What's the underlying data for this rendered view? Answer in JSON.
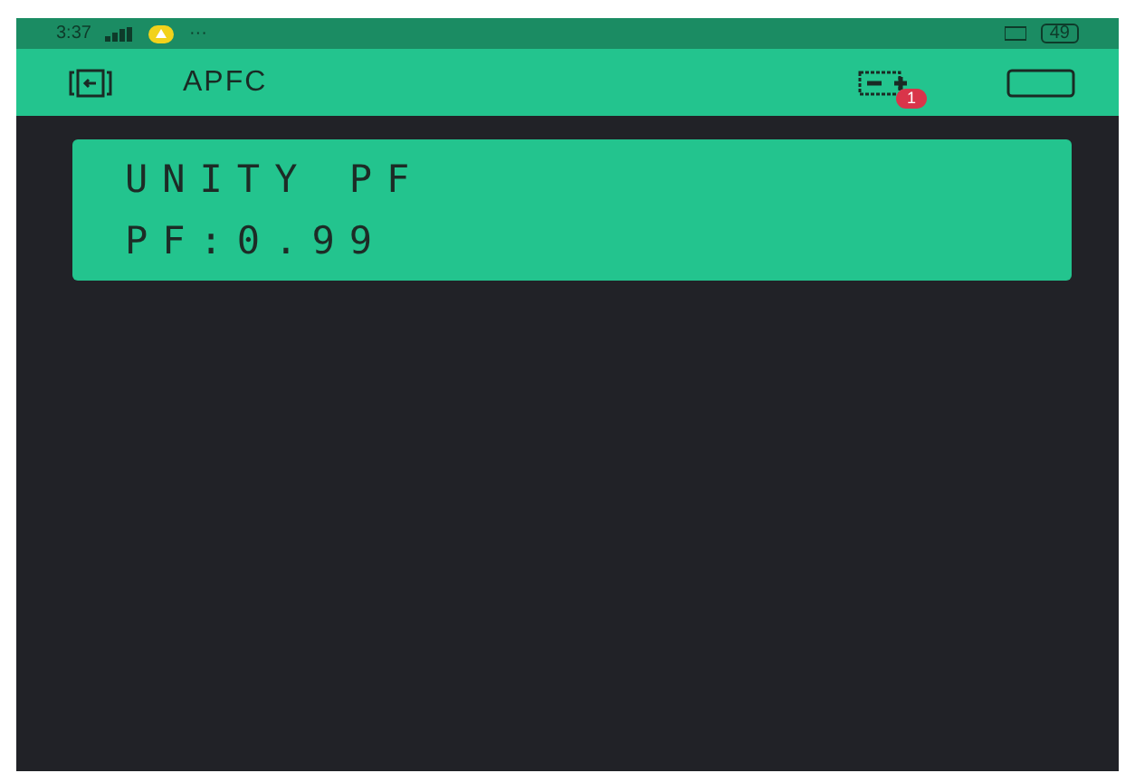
{
  "status_bar": {
    "time": "3:37",
    "more": "···",
    "battery": "49"
  },
  "header": {
    "title": "APFC",
    "notification_count": "1"
  },
  "lcd": {
    "lines": [
      "UNITY PF",
      "PF:0.99"
    ]
  }
}
